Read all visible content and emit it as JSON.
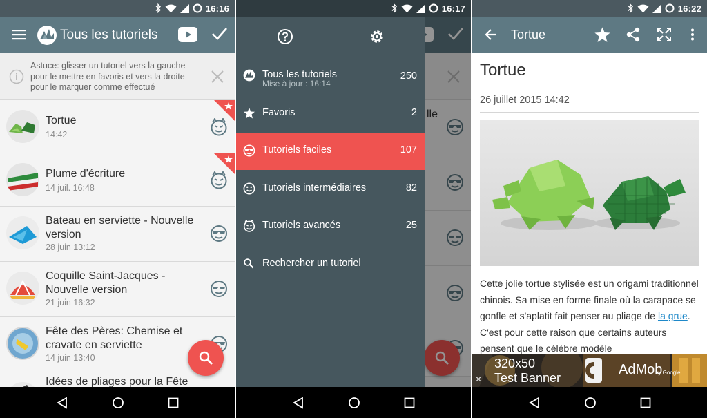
{
  "screen1": {
    "status": {
      "time": "16:16"
    },
    "appbar": {
      "title": "Tous les tutoriels"
    },
    "tip": {
      "text": "Astuce: glisser un tutoriel vers la gauche pour le mettre en favoris et vers la droite pour le marquer comme effectué"
    },
    "items": [
      {
        "title": "Tortue",
        "time": "14:42",
        "difficulty": "hard-devil-icon",
        "favorite": true
      },
      {
        "title": "Plume d'écriture",
        "time": "14 juil. 16:48",
        "difficulty": "hard-devil-icon",
        "favorite": true
      },
      {
        "title": "Bateau en serviette - Nouvelle version",
        "time": "28 juin 13:12",
        "difficulty": "easy-sunglasses-icon",
        "favorite": false
      },
      {
        "title": "Coquille Saint-Jacques - Nouvelle version",
        "time": "21 juin 16:32",
        "difficulty": "easy-sunglasses-icon",
        "favorite": false
      },
      {
        "title": "Fête des Pères: Chemise et cravate en serviette",
        "time": "14 juin 13:40",
        "difficulty": "easy-sunglasses-icon",
        "favorite": false
      },
      {
        "title": "Idées de pliages pour la Fête",
        "time": "",
        "difficulty": "",
        "favorite": false
      }
    ]
  },
  "screen2": {
    "status": {
      "time": "16:17"
    },
    "background_fragment": "lle",
    "drawer": {
      "all": {
        "label": "Tous les tutoriels",
        "count": "250",
        "sub": "Mise à jour : 16:14"
      },
      "favorites": {
        "label": "Favoris",
        "count": "2"
      },
      "easy": {
        "label": "Tutoriels faciles",
        "count": "107"
      },
      "intermediate": {
        "label": "Tutoriels intermédiaires",
        "count": "82"
      },
      "advanced": {
        "label": "Tutoriels avancés",
        "count": "25"
      },
      "search": {
        "label": "Rechercher un tutoriel"
      }
    }
  },
  "screen3": {
    "status": {
      "time": "16:22"
    },
    "appbar": {
      "title": "Tortue"
    },
    "article": {
      "title": "Tortue",
      "date": "26 juillet 2015 14:42",
      "text_before_link": "Cette jolie tortue stylisée est un origami traditionnel chinois. Sa mise en forme finale où la carapace se gonfle et s'aplatit fait penser au pliage de ",
      "link": "la grue",
      "text_after_link": ". C'est pour cette raison que certains auteurs pensent que le célèbre modèle"
    },
    "ad": {
      "size": "320x50",
      "label": "Test Banner",
      "brand": "AdMob",
      "by": "by Google",
      "close": "✕"
    }
  },
  "colors": {
    "statusbar": "#4b5960",
    "appbar": "#5e7983",
    "drawer": "#46575e",
    "accent": "#ef5350",
    "link": "#1e88c9"
  }
}
